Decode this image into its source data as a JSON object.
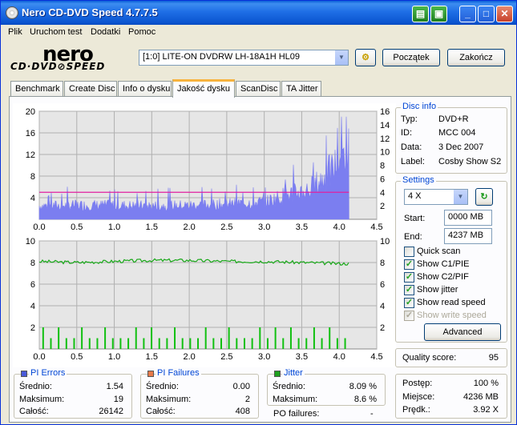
{
  "window": {
    "title": "Nero CD-DVD Speed 4.7.7.5"
  },
  "menu": [
    "Plik",
    "Uruchom test",
    "Dodatki",
    "Pomoc"
  ],
  "logo": {
    "word": "nero",
    "sub": "CD·DVD⊘SPEED"
  },
  "drive": {
    "value": "[1:0]  LITE-ON DVDRW LH-18A1H HL09"
  },
  "buttons": {
    "start": "Początek",
    "exit": "Zakończ",
    "advanced": "Advanced"
  },
  "tabs": [
    "Benchmark",
    "Create Disc",
    "Info o dysku",
    "Jakość dysku",
    "ScanDisc",
    "TA Jitter"
  ],
  "active_tab": "Jakość dysku",
  "disc_info": {
    "title": "Disc info",
    "rows": [
      {
        "label": "Typ:",
        "value": "DVD+R"
      },
      {
        "label": "ID:",
        "value": "MCC 004"
      },
      {
        "label": "Data:",
        "value": "3 Dec 2007"
      },
      {
        "label": "Label:",
        "value": "Cosby Show S2"
      }
    ]
  },
  "settings": {
    "title": "Settings",
    "speed": "4 X",
    "start_label": "Start:",
    "start_value": "0000 MB",
    "end_label": "End:",
    "end_value": "4237 MB",
    "checks": [
      {
        "label": "Quick scan",
        "checked": false,
        "disabled": false
      },
      {
        "label": "Show C1/PIE",
        "checked": true,
        "disabled": false
      },
      {
        "label": "Show C2/PIF",
        "checked": true,
        "disabled": false
      },
      {
        "label": "Show jitter",
        "checked": true,
        "disabled": false
      },
      {
        "label": "Show read speed",
        "checked": true,
        "disabled": false
      },
      {
        "label": "Show write speed",
        "checked": true,
        "disabled": true
      }
    ]
  },
  "quality": {
    "label": "Quality score:",
    "value": "95"
  },
  "progress": {
    "rows": [
      {
        "label": "Postęp:",
        "value": "100 %"
      },
      {
        "label": "Miejsce:",
        "value": "4236 MB"
      },
      {
        "label": "Prędk.:",
        "value": "3.92 X"
      }
    ]
  },
  "stats": {
    "pi_errors": {
      "title": "PI Errors",
      "color": "#4a5ad8",
      "rows": [
        {
          "label": "Średnio:",
          "value": "1.54"
        },
        {
          "label": "Maksimum:",
          "value": "19"
        },
        {
          "label": "Całość:",
          "value": "26142"
        }
      ]
    },
    "pi_failures": {
      "title": "PI Failures",
      "color": "#e87a4a",
      "rows": [
        {
          "label": "Średnio:",
          "value": "0.00"
        },
        {
          "label": "Maksimum:",
          "value": "2"
        },
        {
          "label": "Całość:",
          "value": "408"
        }
      ]
    },
    "jitter": {
      "title": "Jitter",
      "color": "#1ea01e",
      "rows": [
        {
          "label": "Średnio:",
          "value": "8.09 %"
        },
        {
          "label": "Maksimum:",
          "value": "8.6 %"
        }
      ],
      "po_label": "PO failures:",
      "po_value": "-"
    }
  },
  "colors": {
    "pie": "#7b7ef0",
    "speed": "#e020a0",
    "pif": "#10c010",
    "jitter": "#18a818",
    "plot_bg": "#e6e6e6",
    "grid": "#b0b0b0"
  },
  "chart_data": [
    {
      "type": "area",
      "title": "",
      "x_ticks": [
        "0.0",
        "0.5",
        "1.0",
        "1.5",
        "2.0",
        "2.5",
        "3.0",
        "3.5",
        "4.0",
        "4.5"
      ],
      "xlim": [
        0,
        4.5
      ],
      "ylim_left": [
        0,
        20
      ],
      "y_ticks_left": [
        "4",
        "8",
        "12",
        "16",
        "20"
      ],
      "ylim_right": [
        0,
        16
      ],
      "y_ticks_right": [
        "2",
        "4",
        "6",
        "8",
        "10",
        "12",
        "14",
        "16"
      ],
      "grid": true,
      "series": [
        {
          "name": "PI Errors",
          "axis": "left",
          "style": "bars",
          "x_end": 4.13,
          "profile": [
            [
              0,
              2.5
            ],
            [
              0.5,
              2.6
            ],
            [
              1.0,
              2.6
            ],
            [
              1.5,
              2.5
            ],
            [
              2.0,
              2.6
            ],
            [
              2.5,
              2.8
            ],
            [
              3.0,
              3.2
            ],
            [
              3.3,
              4.5
            ],
            [
              3.6,
              5.5
            ],
            [
              3.8,
              7.5
            ],
            [
              3.95,
              10
            ],
            [
              4.05,
              12
            ],
            [
              4.13,
              13
            ]
          ]
        },
        {
          "name": "Read speed",
          "axis": "right",
          "style": "line",
          "x": [
            0,
            4.13
          ],
          "y": [
            4,
            4
          ]
        }
      ]
    },
    {
      "type": "line",
      "title": "",
      "x_ticks": [
        "0.0",
        "0.5",
        "1.0",
        "1.5",
        "2.0",
        "2.5",
        "3.0",
        "3.5",
        "4.0",
        "4.5"
      ],
      "xlim": [
        0,
        4.5
      ],
      "ylim_left": [
        0,
        10
      ],
      "y_ticks_left": [
        "2",
        "4",
        "6",
        "8",
        "10"
      ],
      "ylim_right": [
        0,
        10
      ],
      "y_ticks_right": [
        "2",
        "4",
        "6",
        "8",
        "10"
      ],
      "grid": true,
      "series": [
        {
          "name": "PI Failures",
          "axis": "left",
          "style": "spikes",
          "x_end": 4.13,
          "values": [
            2,
            1,
            2,
            1,
            1,
            2,
            1,
            1,
            2,
            1,
            1,
            1,
            2,
            1,
            2,
            1,
            1,
            2,
            1,
            1,
            1,
            2,
            1,
            1,
            2,
            1,
            1,
            1,
            2,
            1,
            2,
            1,
            2,
            1,
            1,
            2,
            1,
            2,
            1,
            1
          ]
        },
        {
          "name": "Jitter",
          "axis": "right",
          "style": "line",
          "x": [
            0,
            0.5,
            1.0,
            1.5,
            2.0,
            2.5,
            3.0,
            3.5,
            4.0,
            4.13
          ],
          "y": [
            8.1,
            8.0,
            8.1,
            8.2,
            8.2,
            8.1,
            8.1,
            8.0,
            7.9,
            7.9
          ]
        }
      ]
    }
  ]
}
